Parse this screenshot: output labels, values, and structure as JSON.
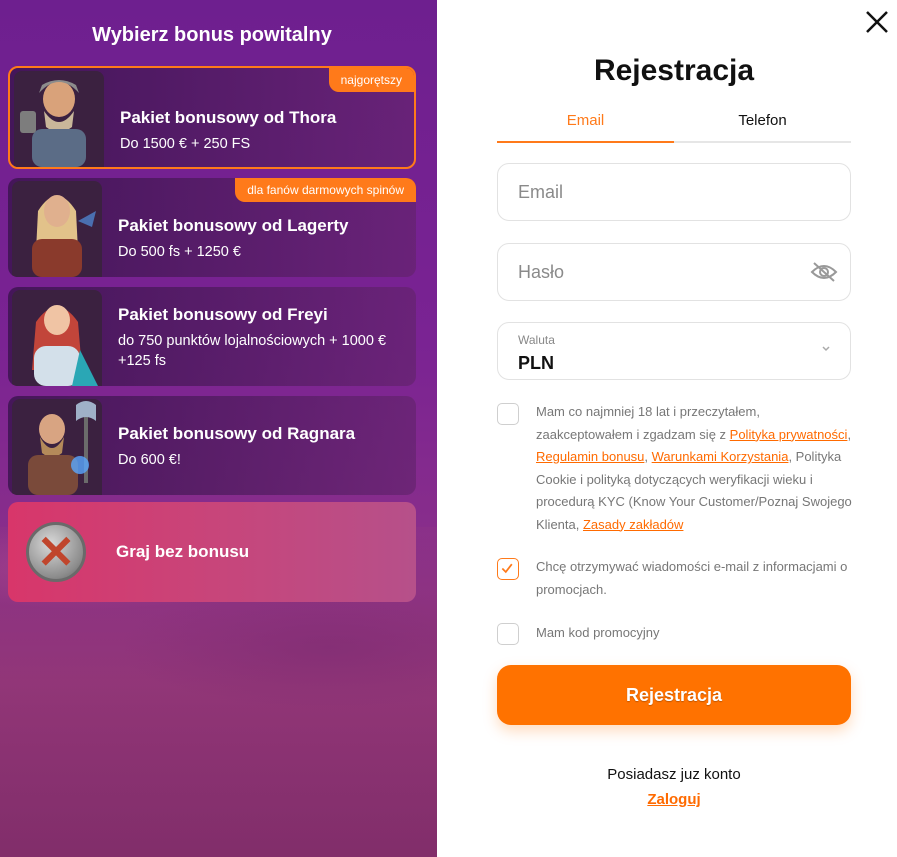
{
  "left": {
    "title": "Wybierz bonus powitalny",
    "cards": [
      {
        "title": "Pakiet bonusowy od Thora",
        "sub": "Do 1500 € + 250 FS",
        "badge": "najgorętszy"
      },
      {
        "title": "Pakiet bonusowy od Lagerty",
        "sub": "Do 500 fs + 1250 €",
        "badge": "dla fanów darmowych spinów"
      },
      {
        "title": "Pakiet bonusowy od Freyi",
        "sub": "do 750 punktów lojalnościowych + 1000 € +125 fs"
      },
      {
        "title": "Pakiet bonusowy od Ragnara",
        "sub": "Do 600 €!"
      }
    ],
    "no_bonus": "Graj bez bonusu"
  },
  "form": {
    "title": "Rejestracja",
    "tabs": [
      "Email",
      "Telefon"
    ],
    "email_placeholder": "Email",
    "password_placeholder": "Hasło",
    "currency_label": "Waluta",
    "currency_value": "PLN",
    "terms": {
      "t1": "Mam co najmniej 18 lat i przeczytałem, zaakceptowałem i zgadzam się z ",
      "l1": "Polityka prywatności",
      "sep1": ", ",
      "l2": "Regulamin bonusu",
      "sep2": ", ",
      "l3": "Warunkami Korzystania",
      "t2": ", Polityka Cookie i polityką dotyczących weryfikacji wieku i procedurą KYC (Know Your Customer/Poznaj Swojego Klienta, ",
      "l4": "Zasady zakładów"
    },
    "newsletter": "Chcę otrzymywać wiadomości e-mail z informacjami o promocjach.",
    "promo": "Mam kod promocyjny",
    "submit": "Rejestracja",
    "have_account": "Posiadasz juz konto",
    "login": "Zaloguj"
  },
  "colors": {
    "accent": "#ff7200",
    "panel": "#7a2393"
  }
}
